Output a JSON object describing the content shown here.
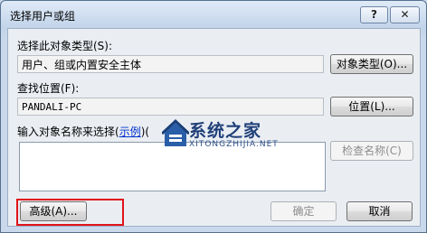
{
  "window": {
    "title": "选择用户或组",
    "help_glyph": "?",
    "close_glyph": "✕"
  },
  "object_type": {
    "label": "选择此对象类型(S):",
    "value": "用户、组或内置安全主体",
    "button": "对象类型(O)..."
  },
  "location": {
    "label": "查找位置(F):",
    "value": "PANDALI-PC",
    "button": "位置(L)..."
  },
  "names": {
    "label_prefix": "输入对象名称来选择(",
    "label_link": "示例",
    "label_suffix": ")(",
    "check_button": "检查名称(C)"
  },
  "footer": {
    "advanced_button": "高级(A)...",
    "ok_button": "确定",
    "cancel_button": "取消"
  },
  "watermark": {
    "brand": "系统之家",
    "url": "XITONGZHIJIA.NET"
  },
  "colors": {
    "highlight": "#e0141b",
    "link": "#0033cc"
  }
}
